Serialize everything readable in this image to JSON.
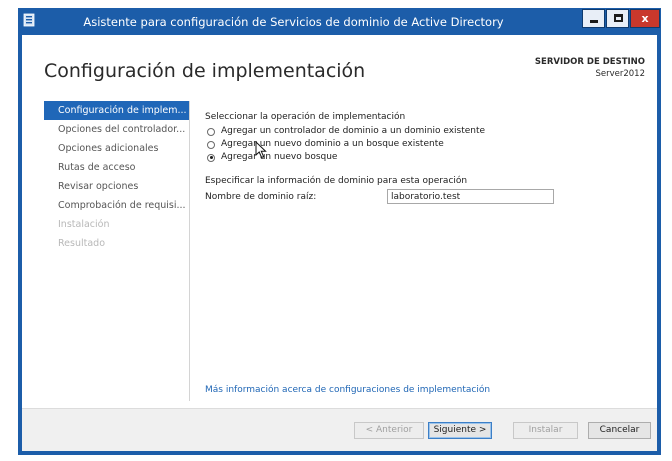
{
  "window": {
    "title": "Asistente para configuración de Servicios de dominio de Active Directory",
    "close_glyph": "x"
  },
  "header": {
    "page_title": "Configuración de implementación",
    "destination_label": "SERVIDOR DE DESTINO",
    "destination_value": "Server2012"
  },
  "sidebar": {
    "items": [
      {
        "label": "Configuración de implem...",
        "state": "selected"
      },
      {
        "label": "Opciones del controlador...",
        "state": "enabled"
      },
      {
        "label": "Opciones adicionales",
        "state": "enabled"
      },
      {
        "label": "Rutas de acceso",
        "state": "enabled"
      },
      {
        "label": "Revisar opciones",
        "state": "enabled"
      },
      {
        "label": "Comprobación de requisi...",
        "state": "enabled"
      },
      {
        "label": "Instalación",
        "state": "disabled"
      },
      {
        "label": "Resultado",
        "state": "disabled"
      }
    ]
  },
  "main": {
    "operation_label": "Seleccionar la operación de implementación",
    "options": [
      {
        "label": "Agregar un controlador de dominio a un dominio existente",
        "checked": false
      },
      {
        "label": "Agregar un nuevo dominio a un bosque existente",
        "checked": false
      },
      {
        "label": "Agregar un nuevo bosque",
        "checked": true
      }
    ],
    "domain_info_label": "Especificar la información de dominio para esta operación",
    "root_domain_label": "Nombre de dominio raíz:",
    "root_domain_value": "laboratorio.test",
    "more_info_link": "Más información acerca de configuraciones de implementación"
  },
  "footer": {
    "back_label": "< Anterior",
    "next_label": "Siguiente >",
    "install_label": "Instalar",
    "cancel_label": "Cancelar"
  },
  "colors": {
    "accent": "#2067b8",
    "titlebar": "#1c5da9",
    "link": "#1f66b5",
    "close": "#c9382c"
  },
  "icons": [
    "server-manager-icon",
    "minimize-icon",
    "maximize-icon",
    "close-icon",
    "mouse-pointer-icon"
  ]
}
